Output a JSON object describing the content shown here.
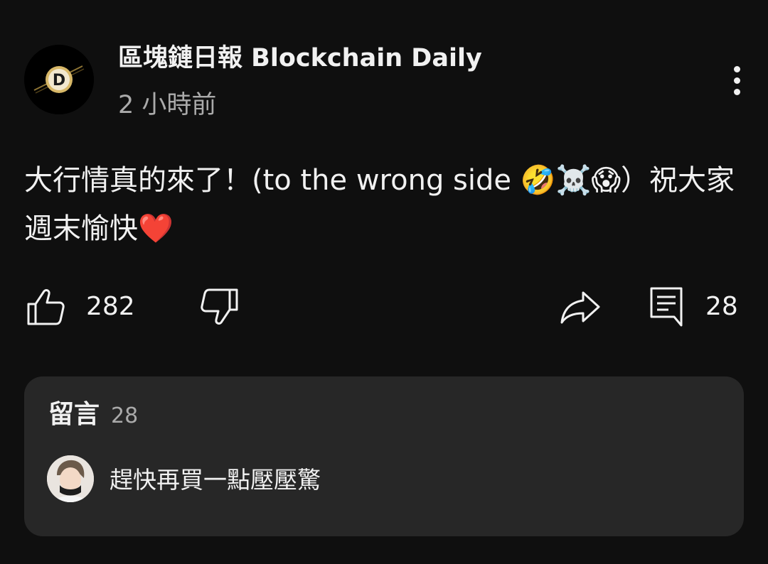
{
  "post": {
    "channel_name": "區塊鏈日報 Blockchain Daily",
    "timestamp": "2 小時前",
    "text": "大行情真的來了！(to the wrong side 🤣☠️😱）祝大家週末愉快❤️"
  },
  "actions": {
    "like_icon": "thumbs-up-icon",
    "like_count": "282",
    "dislike_icon": "thumbs-down-icon",
    "share_icon": "share-icon",
    "comment_icon": "comment-icon",
    "comment_count": "28"
  },
  "comments": {
    "title": "留言",
    "count": "28",
    "top_comment": {
      "text": "趕快再買一點壓壓驚"
    }
  },
  "colors": {
    "background": "#0f0f0f",
    "card": "#272727",
    "text_primary": "#f1f1f1",
    "text_secondary": "#aaaaaa",
    "avatar_gold": "#c9a54a"
  }
}
